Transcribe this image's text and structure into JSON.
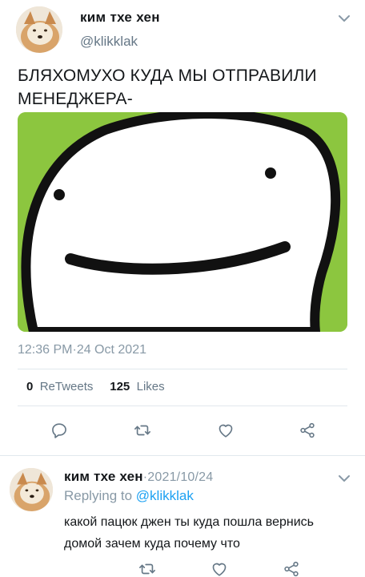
{
  "tweet": {
    "author_name": "ким тхе хен",
    "author_handle": "@klikklak",
    "text": "БЛЯХОМУХО КУДА МЫ ОТПРАВИЛИ МЕНЕДЖЕРА-",
    "timestamp": "12:36 PM·24 Oct 2021",
    "retweets_count": "0",
    "retweets_label": "ReTweets",
    "likes_count": "125",
    "likes_label": "Likes"
  },
  "reply": {
    "author_name": "ким тхе хен",
    "date": "·2021/10/24",
    "replying_prefix": "Replying to ",
    "replying_handle": "@klikklak",
    "text": "какой пацюк джен ты куда пошла вернись домой зачем куда почему что"
  },
  "icons": {
    "reply": "reply-icon",
    "retweet": "retweet-icon",
    "like": "heart-icon",
    "share": "share-icon",
    "more": "chevron-down-icon"
  },
  "colors": {
    "accent": "#1da1f2",
    "muted": "#8899a6",
    "media_background": "#8cc63f"
  }
}
